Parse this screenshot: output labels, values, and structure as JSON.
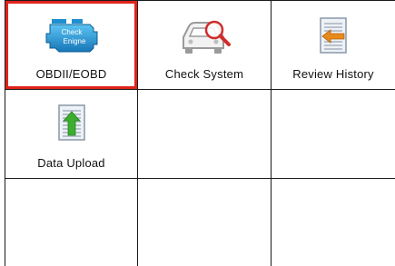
{
  "menu": {
    "items": [
      {
        "label": "OBDII/EOBD",
        "icon": "check-engine-icon",
        "selected": true
      },
      {
        "label": "Check System",
        "icon": "car-search-icon",
        "selected": false
      },
      {
        "label": "Review History",
        "icon": "review-history-icon",
        "selected": false
      },
      {
        "label": "Data Upload",
        "icon": "data-upload-icon",
        "selected": false
      }
    ],
    "check_engine_text_1": "Check",
    "check_engine_text_2": "Enigne"
  },
  "colors": {
    "selection": "#e0241b",
    "engine_blue": "#1e8fd0",
    "arrow_orange": "#e68a1a",
    "arrow_green": "#3cae2f"
  }
}
